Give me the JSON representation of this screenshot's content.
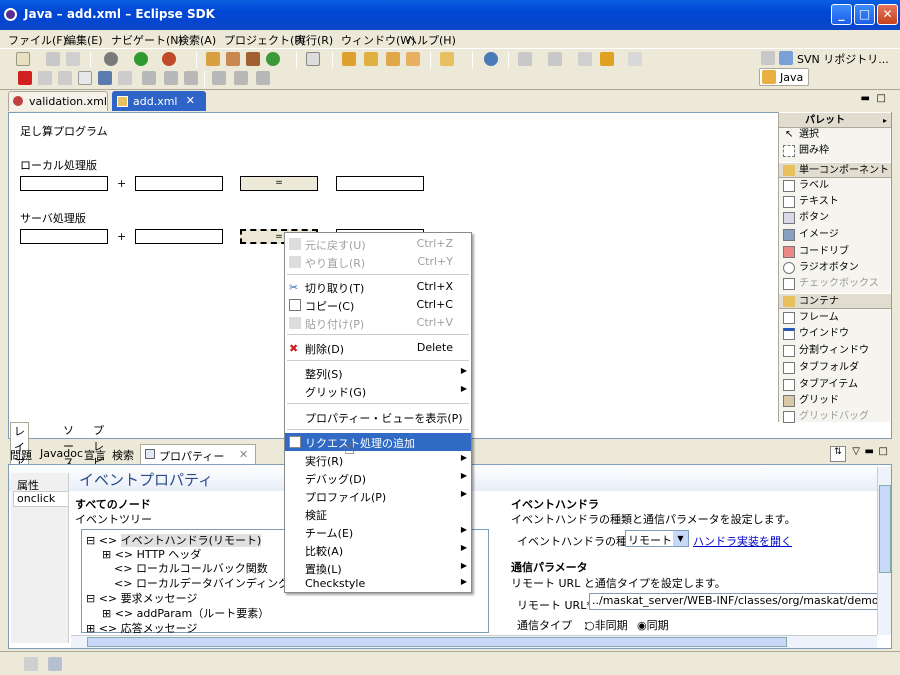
{
  "window": {
    "title": "Java – add.xml – Eclipse SDK"
  },
  "menu": [
    "ファイル(F)",
    "編集(E)",
    "ナビゲート(N)",
    "検索(A)",
    "プロジェクト(P)",
    "実行(R)",
    "ウィンドウ(W)",
    "ヘルプ(H)"
  ],
  "perspective": {
    "svn_label": "SVN リポジトリ...",
    "java_label": "Java"
  },
  "editor_tabs": [
    {
      "label": "validation.xml"
    },
    {
      "label": "add.xml"
    }
  ],
  "canvas": {
    "title": "足し算プログラム",
    "local_label": "ローカル処理版",
    "server_label": "サーバ処理版",
    "plus": "+",
    "equals": "="
  },
  "palette": {
    "title": "パレット",
    "select": "選択",
    "marquee": "囲み枠",
    "single_components": "単一コンポーネント",
    "items_single": [
      "ラベル",
      "テキスト",
      "ボタン",
      "イメージ",
      "コードリブ",
      "ラジオボタン",
      "チェックボックス"
    ],
    "containers": "コンテナ",
    "items_container": [
      "フレーム",
      "ウインドウ",
      "分割ウィンドウ",
      "タブフォルダ",
      "タブアイテム",
      "グリッド",
      "グリッドバッグ"
    ]
  },
  "editor_bottom_tabs": [
    "レイアウト",
    "ソース",
    "プレビュー"
  ],
  "view_tabs": [
    "問題",
    "Javadoc",
    "宣言",
    "検索",
    "プロパティー"
  ],
  "properties": {
    "title": "イベントプロパティ",
    "side_tab": "属性",
    "side_item": "onclick",
    "all_nodes": "すべてのノード",
    "event_tree": "イベントツリー",
    "tree": [
      "イベントハンドラ(リモート)",
      "HTTP ヘッダ",
      "ローカルコールバック関数",
      "ローカルデータバインディング",
      "要求メッセージ",
      "addParam（ルート要素）",
      "応答メッセージ"
    ],
    "handler_section": "イベントハンドラ",
    "handler_desc": "イベントハンドラの種類と通信パラメータを設定します。",
    "handler_type_label": "イベントハンドラの種類*：",
    "handler_type_value": "リモート",
    "handler_link": "ハンドラ実装を開く",
    "comm_section": "通信パラメータ",
    "comm_desc": "リモート URL と通信タイプを設定します。",
    "remote_url_label": "リモート URL*：",
    "remote_url_value": "../maskat_server/WEB-INF/classes/org/maskat/demo/servlet/",
    "comm_type_label": "通信タイプ　：",
    "async_label": "非同期",
    "sync_label": "同期"
  },
  "context_menu": {
    "items": [
      {
        "label": "元に戻す(U)",
        "shortcut": "Ctrl+Z",
        "disabled": true
      },
      {
        "label": "やり直し(R)",
        "shortcut": "Ctrl+Y",
        "disabled": true
      },
      {
        "label": "切り取り(T)",
        "shortcut": "Ctrl+X"
      },
      {
        "label": "コピー(C)",
        "shortcut": "Ctrl+C"
      },
      {
        "label": "貼り付け(P)",
        "shortcut": "Ctrl+V",
        "disabled": true
      },
      {
        "label": "削除(D)",
        "shortcut": "Delete"
      },
      {
        "label": "整列(S)"
      },
      {
        "label": "グリッド(G)"
      },
      {
        "label": "プロパティー・ビューを表示(P)"
      },
      {
        "label": "リクエスト処理の追加"
      },
      {
        "label": "実行(R)"
      },
      {
        "label": "デバッグ(D)"
      },
      {
        "label": "プロファイル(P)"
      },
      {
        "label": "検証"
      },
      {
        "label": "チーム(E)"
      },
      {
        "label": "比較(A)"
      },
      {
        "label": "置換(L)"
      },
      {
        "label": "Checkstyle"
      }
    ]
  }
}
